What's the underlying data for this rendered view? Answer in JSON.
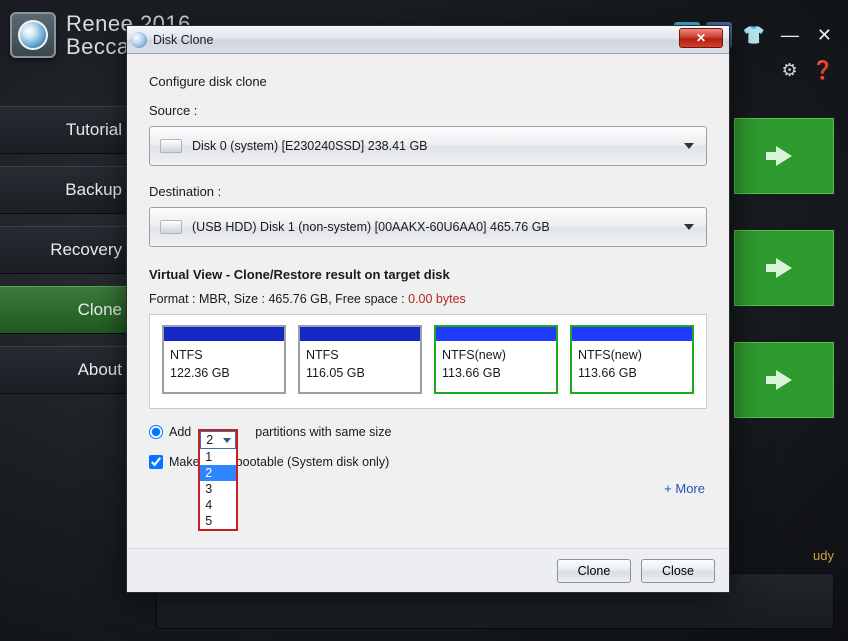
{
  "app": {
    "title_line1": "Renee 2016",
    "title_line2": "Becca...",
    "minimize": "—",
    "close": "✕"
  },
  "sidebar": {
    "items": [
      {
        "label": "Tutorial"
      },
      {
        "label": "Backup"
      },
      {
        "label": "Recovery"
      },
      {
        "label": "Clone"
      },
      {
        "label": "About"
      }
    ]
  },
  "study_link": "udy",
  "dialog": {
    "title": "Disk Clone",
    "configure": "Configure disk clone",
    "source_label": "Source :",
    "source_value": "Disk 0 (system) [E230240SSD]   238.41 GB",
    "dest_label": "Destination :",
    "dest_value": "(USB HDD) Disk 1 (non-system) [00AAKX-60U6AA0]   465.76 GB",
    "virtual_heading": "Virtual View - Clone/Restore result on target disk",
    "format_prefix": "Format : MBR,   Size : 465.76 GB,   Free space :   ",
    "format_zero": "0.00 bytes",
    "partitions": [
      {
        "name": "NTFS",
        "size": "122.36 GB",
        "new": false
      },
      {
        "name": "NTFS",
        "size": "116.05 GB",
        "new": false
      },
      {
        "name": "NTFS(new)",
        "size": "113.66 GB",
        "new": true
      },
      {
        "name": "NTFS(new)",
        "size": "113.66 GB",
        "new": true
      }
    ],
    "add_prefix": "Add",
    "add_suffix": "partitions with same size",
    "combo_selected": "2",
    "combo_options": [
      "1",
      "2",
      "3",
      "4",
      "5"
    ],
    "bootable_label": "Make         t disk bootable (System disk only)",
    "more": "+ More",
    "btn_clone": "Clone",
    "btn_close": "Close"
  }
}
